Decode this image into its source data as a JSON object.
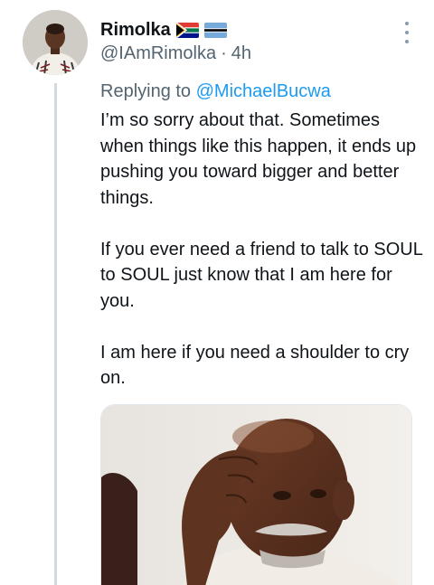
{
  "tweet": {
    "display_name": "Rimolka",
    "flags": [
      "south-africa-flag-icon",
      "botswana-flag-icon"
    ],
    "handle": "@IAmRimolka",
    "separator": "·",
    "timestamp": "4h",
    "replying_prefix": "Replying to",
    "replying_to": "@MichaelBucwa",
    "paragraphs": [
      "I’m so sorry about that. Sometimes when things like this happen, it ends up pushing you toward bigger and better things.",
      "If you ever need a friend to talk to SOUL to SOUL just know that I am here for you.",
      "I am here if you need a shoulder to cry on."
    ],
    "more_icon": "more-vertical-icon",
    "media_kind": "photo"
  },
  "colors": {
    "text": "#0f1419",
    "secondary": "#536471",
    "link": "#1d9bf0",
    "thread_line": "#cfd9de"
  }
}
